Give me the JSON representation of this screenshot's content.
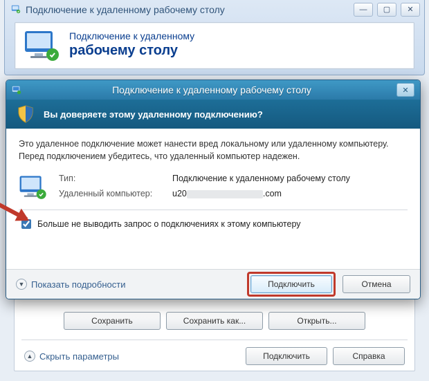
{
  "bgwin": {
    "title": "Подключение к удаленному рабочему столу",
    "header_line1": "Подключение к удаленному",
    "header_line2": "рабочему столу",
    "save": "Сохранить",
    "save_as": "Сохранить как...",
    "open": "Открыть...",
    "hide_params": "Скрыть параметры",
    "connect": "Подключить",
    "help": "Справка"
  },
  "dlg": {
    "title": "Подключение к удаленному рабочему столу",
    "question": "Вы доверяете этому удаленному подключению?",
    "warn": "Это удаленное подключение может нанести вред локальному или удаленному компьютеру. Перед подключением убедитесь, что удаленный компьютер надежен.",
    "type_k": "Тип:",
    "type_v": "Подключение к удаленному рабочему столу",
    "host_k": "Удаленный компьютер:",
    "host_prefix": "u20",
    "host_suffix": ".com",
    "checkbox": "Больше не выводить запрос о подключениях к этому компьютеру",
    "details": "Показать подробности",
    "connect": "Подключить",
    "cancel": "Отмена"
  }
}
